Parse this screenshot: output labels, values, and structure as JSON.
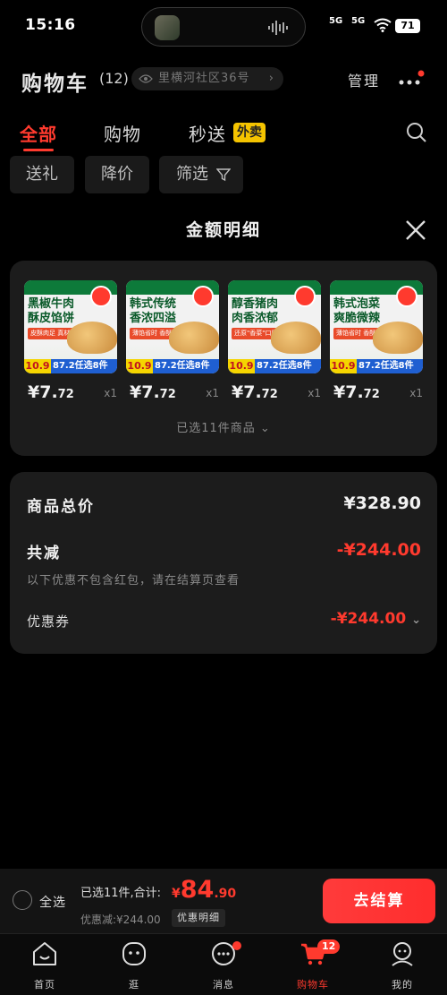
{
  "status": {
    "time": "15:16",
    "net1": "5G",
    "net2": "5G",
    "battery": "71"
  },
  "header": {
    "title": "购物车",
    "count": "(12)",
    "address": "里横河社区36号",
    "manage": "管理"
  },
  "tabs": [
    {
      "label": "全部"
    },
    {
      "label": "购物"
    },
    {
      "label": "秒送"
    }
  ],
  "tab_badge": "外卖",
  "chips": [
    {
      "label": "送礼"
    },
    {
      "label": "降价"
    },
    {
      "label": "筛选"
    }
  ],
  "sheet": {
    "title": "金额明细",
    "products": [
      {
        "headline": "黑椒牛肉酥皮馅饼",
        "sub": "皮酥肉足 真材实料",
        "price_int": "¥7.",
        "price_dec": "72",
        "qty": "x1",
        "tag_price": "10.9",
        "tag_text": "87.2任选8件"
      },
      {
        "headline": "韩式传统香浓四溢",
        "sub": "薄馅省时 香酥可口",
        "price_int": "¥7.",
        "price_dec": "72",
        "qty": "x1",
        "tag_price": "10.9",
        "tag_text": "87.2任选8件"
      },
      {
        "headline": "醇香猪肉肉香浓郁",
        "sub": "还原\"香菜\"口感",
        "price_int": "¥7.",
        "price_dec": "72",
        "qty": "x1",
        "tag_price": "10.9",
        "tag_text": "87.2任选8件"
      },
      {
        "headline": "韩式泡菜爽脆微辣",
        "sub": "薄馅省时 香酥可口",
        "price_int": "¥7.",
        "price_dec": "72",
        "qty": "x1",
        "tag_price": "10.9",
        "tag_text": "87.2任选8件"
      }
    ],
    "selected": "已选11件商品",
    "total_label": "商品总价",
    "total_value": "¥328.90",
    "discount_label": "共减",
    "discount_value": "-¥244.00",
    "note": "以下优惠不包含红包，请在结算页查看",
    "coupon_label": "优惠券",
    "coupon_value": "-¥244.00"
  },
  "checkout": {
    "select_all": "全选",
    "summary": "已选11件,合计:",
    "currency": "¥",
    "amount_big": "84",
    "amount_dec": ".90",
    "discount": "优惠减:¥244.00",
    "detail_button": "优惠明细",
    "pay_button": "去结算"
  },
  "nav": [
    {
      "label": "首页"
    },
    {
      "label": "逛"
    },
    {
      "label": "消息"
    },
    {
      "label": "购物车"
    },
    {
      "label": "我的"
    }
  ],
  "cart_badge": "12",
  "colors": {
    "accent": "#ff3a2e",
    "background": "#000000",
    "card": "#1c1c1c",
    "promo_blue": "#1f5fd1",
    "promo_yellow": "#f5d500"
  }
}
